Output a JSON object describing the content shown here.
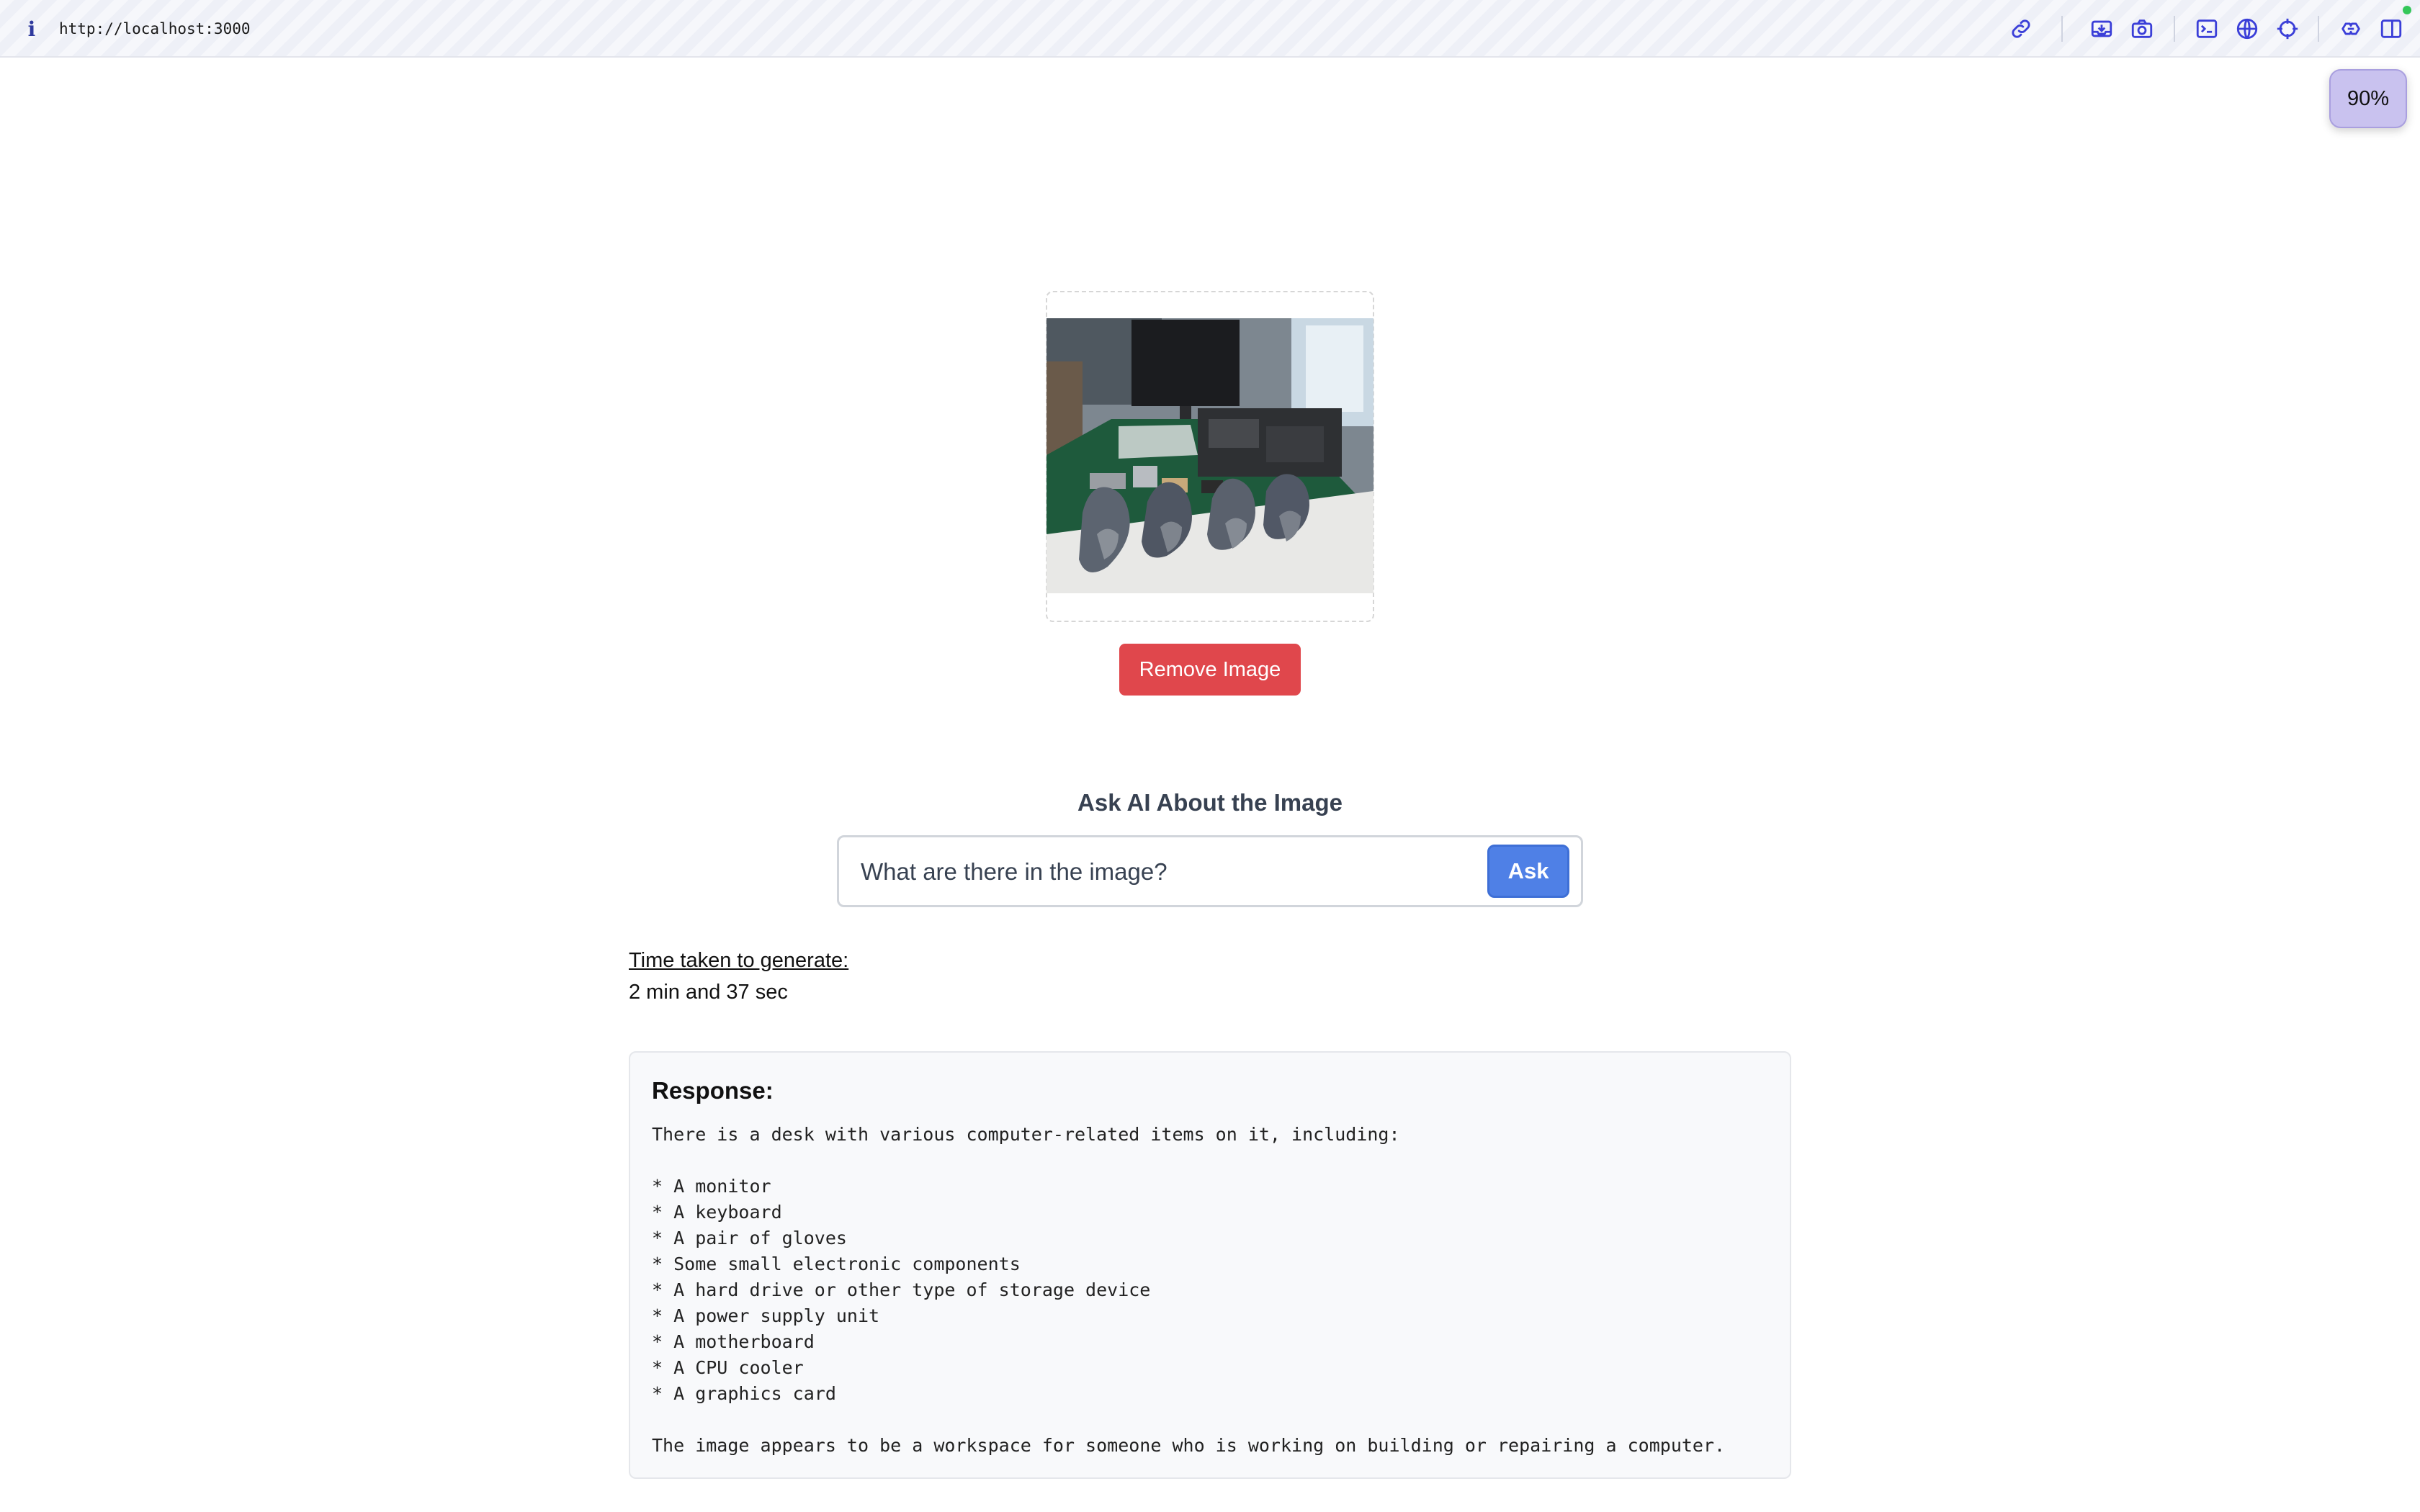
{
  "browser": {
    "url": "http://localhost:3000",
    "info_icon": "info-icon",
    "toolbar_icons": [
      "link-icon",
      "inbox-icon",
      "camera-icon",
      "terminal-icon",
      "globe-icon",
      "crosshair-icon",
      "brain-icon",
      "split-view-icon"
    ],
    "zoom": "90%"
  },
  "image_upload": {
    "remove_label": "Remove Image"
  },
  "ask": {
    "title": "Ask AI About the Image",
    "input_value": "What are there in the image?",
    "button_label": "Ask"
  },
  "timing": {
    "label": "Time taken to generate:",
    "value": "2 min and 37 sec"
  },
  "response": {
    "title": "Response:",
    "text": "There is a desk with various computer-related items on it, including:\n\n* A monitor\n* A keyboard\n* A pair of gloves\n* Some small electronic components\n* A hard drive or other type of storage device\n* A power supply unit\n* A motherboard\n* A CPU cooler\n* A graphics card\n\nThe image appears to be a workspace for someone who is working on building or repairing a computer."
  },
  "colors": {
    "remove_button": "#e0474c",
    "ask_button": "#4f80e6",
    "zoom_badge": "#c9c2ef",
    "response_bg": "#f8f9fb"
  }
}
